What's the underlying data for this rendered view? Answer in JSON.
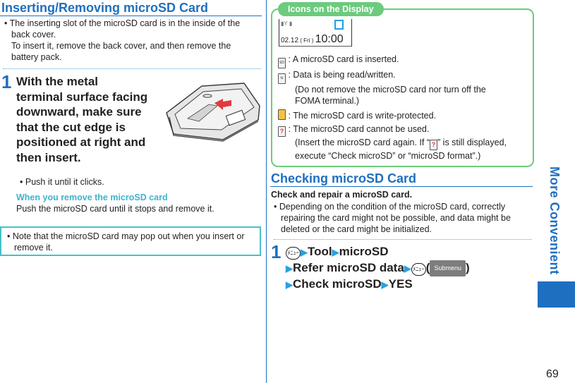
{
  "left": {
    "title": "Inserting/Removing microSD Card",
    "intro_bullet": "The inserting slot of the microSD card is in the inside of the back cover.",
    "intro_line2": "To insert it, remove the back cover, and then remove the battery pack.",
    "step": {
      "number": "1",
      "lines": [
        "With the metal",
        "terminal surface facing",
        "downward, make sure",
        "that the cut edge is",
        "positioned at right and",
        "then insert."
      ],
      "bullet": "Push it until it clicks."
    },
    "remove_heading": "When you remove the microSD card",
    "remove_text": "Push the microSD card until it stops and remove it.",
    "note": "Note that the microSD card may pop out when you insert or remove it.",
    "illustration_label": "phone-back-with-microsd-slot"
  },
  "icons_box": {
    "tab_label": "Icons on the Display",
    "screen": {
      "date": "02.12",
      "day": "Fri",
      "time": "10:00"
    },
    "items": [
      {
        "icon": "sd-inserted-icon",
        "glyph": "SD",
        "text": "A microSD card is inserted."
      },
      {
        "icon": "sd-read-write-icon",
        "glyph": "⇅",
        "text": "Data is being read/written.",
        "sub": [
          "(Do not remove the microSD card nor turn off the",
          "FOMA terminal.)"
        ]
      },
      {
        "icon": "sd-write-protected-icon",
        "glyph": "🔒",
        "text": "The microSD card is write-protected."
      },
      {
        "icon": "sd-unusable-icon",
        "glyph": "?",
        "text": "The microSD card cannot be used.",
        "sub": [
          "(Insert the microSD card again. If “",
          "” is still displayed,",
          "execute “Check microSD” or “microSD format”.)"
        ]
      }
    ]
  },
  "right": {
    "title": "Checking microSD Card",
    "lead": "Check and repair a microSD card.",
    "bullet": "Depending on the condition of the microSD card, correctly repairing the card might not be possible, and data might be deleted or the card might be initialized.",
    "step": {
      "number": "1",
      "menu_key": "ﾒﾆｭｰ",
      "path1": [
        "Tool",
        "microSD"
      ],
      "path2": "Refer microSD data",
      "submenu": "Submenu",
      "path3": [
        "Check microSD",
        "YES"
      ]
    }
  },
  "side": {
    "label": "More Convenient",
    "color": "#1f6fc0"
  },
  "page_number": "69"
}
